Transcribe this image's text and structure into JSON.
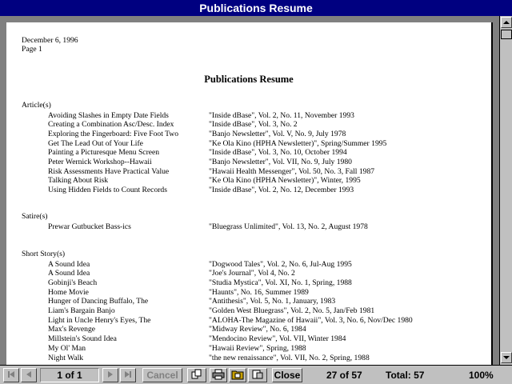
{
  "window": {
    "title": "Publications Resume"
  },
  "page": {
    "date": "December 6, 1996",
    "page_label": "Page 1",
    "title": "Publications Resume",
    "sections": [
      {
        "heading": "Article(s)",
        "items": [
          {
            "title": "Avoiding Slashes in Empty Date Fields",
            "pub": "\"Inside dBase\", Vol. 2, No. 11, November 1993"
          },
          {
            "title": "Creating a Combination Asc/Desc. Index",
            "pub": "\"Inside dBase\", Vol. 3, No. 2"
          },
          {
            "title": "Exploring the Fingerboard: Five Foot Two",
            "pub": "\"Banjo Newsletter\", Vol. V, No. 9, July 1978"
          },
          {
            "title": "Get The Lead Out of Your Life",
            "pub": "\"Ke Ola Kino (HPHA Newsletter)\", Spring/Summer 1995"
          },
          {
            "title": "Painting a Picturesque Menu Screen",
            "pub": "\"Inside dBase\", Vol. 3, No. 10, October 1994"
          },
          {
            "title": "Peter Wernick Workshop--Hawaii",
            "pub": "\"Banjo Newsletter\", Vol. VII, No. 9, July 1980"
          },
          {
            "title": "Risk Assessments Have Practical Value",
            "pub": "\"Hawaii Health Messenger\", Vol. 50, No. 3, Fall 1987"
          },
          {
            "title": "Talking About Risk",
            "pub": "\"Ke Ola Kino (HPHA Newsletter)\", Winter, 1995"
          },
          {
            "title": "Using Hidden Fields to Count Records",
            "pub": "\"Inside dBase\", Vol. 2, No. 12, December 1993"
          }
        ]
      },
      {
        "heading": "Satire(s)",
        "items": [
          {
            "title": "Prewar Gutbucket Bass-ics",
            "pub": "\"Bluegrass Unlimited\", Vol. 13, No. 2, August 1978"
          }
        ]
      },
      {
        "heading": "Short Story(s)",
        "items": [
          {
            "title": "A Sound Idea",
            "pub": "\"Dogwood Tales\", Vol. 2, No. 6, Jul-Aug 1995"
          },
          {
            "title": "A Sound Idea",
            "pub": "\"Joe's Journal\", Vol 4, No. 2"
          },
          {
            "title": "Gobinji's Beach",
            "pub": "\"Studia Mystica\", Vol. XI, No. 1, Spring, 1988"
          },
          {
            "title": "Home Movie",
            "pub": "\"Haunts\", No. 16, Summer 1989"
          },
          {
            "title": "Hunger of Dancing Buffalo, The",
            "pub": "\"Antithesis\", Vol. 5, No. 1, January, 1983"
          },
          {
            "title": "Liam's Bargain Banjo",
            "pub": "\"Golden West Bluegrass\", Vol. 2, No. 5, Jan/Feb 1981"
          },
          {
            "title": "Light in Uncle Henry's Eyes, The",
            "pub": "\"ALOHA-The Magazine of Hawaii\", Vol. 3, No. 6, Nov/Dec 1980"
          },
          {
            "title": "Max's Revenge",
            "pub": "\"Midway Review\", No. 6, 1984"
          },
          {
            "title": "Millstein's Sound Idea",
            "pub": "\"Mendocino Review\", Vol. VII, Winter 1984"
          },
          {
            "title": "My Ol' Man",
            "pub": "\"Hawaii Review\", Spring, 1988"
          },
          {
            "title": "Night Walk",
            "pub": "\"the new renaissance\", Vol. VII, No. 2, Spring, 1988"
          }
        ]
      }
    ]
  },
  "toolbar": {
    "page_of": "1 of 1",
    "cancel": "Cancel",
    "close": "Close",
    "record": "27 of 57",
    "total": "Total: 57",
    "zoom": "100%"
  },
  "colors": {
    "titlebar": "#000080",
    "chrome": "#c0c0c0",
    "canvas": "#808080"
  }
}
